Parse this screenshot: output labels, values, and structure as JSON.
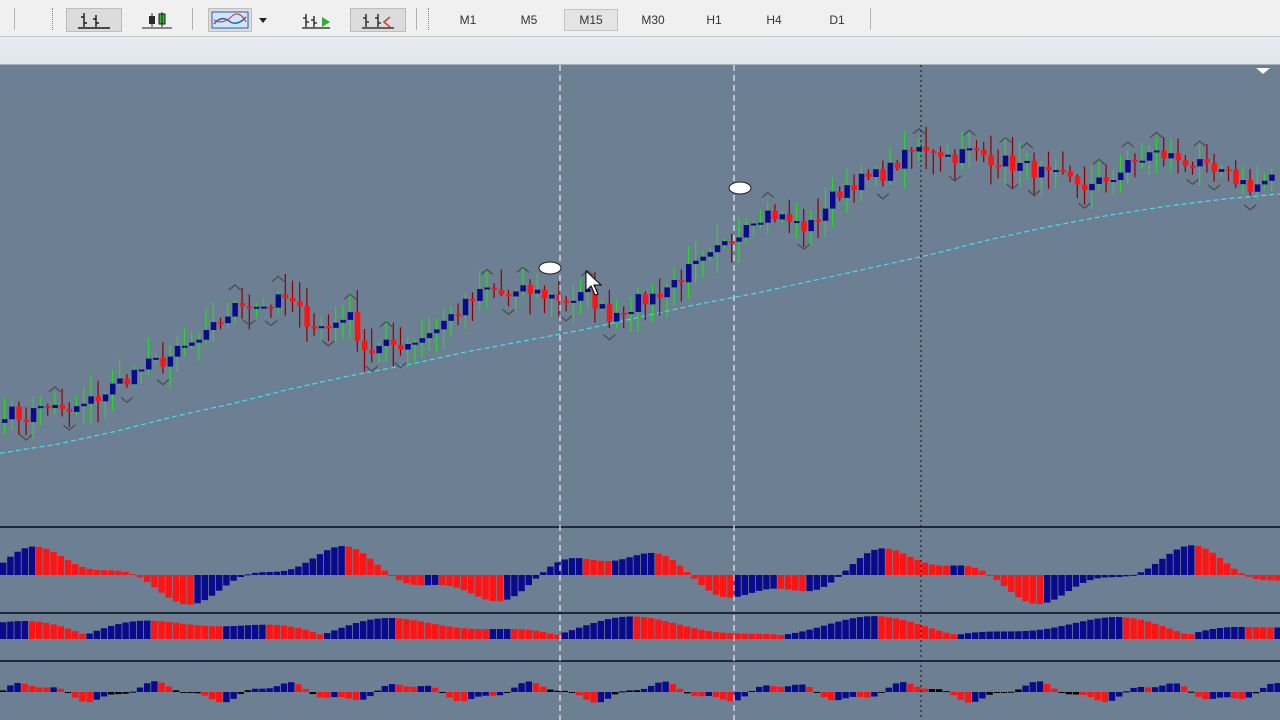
{
  "toolbar": {
    "timeframes": [
      "M1",
      "M5",
      "M15",
      "M30",
      "H1",
      "H4",
      "D1"
    ],
    "active_timeframe": "M15",
    "icons": [
      "bar-chart-icon",
      "candlestick-chart-icon",
      "line-chart-icon",
      "dropdown-arrow-icon",
      "zoom-in-icon",
      "zoom-out-icon"
    ]
  },
  "colors": {
    "background": "#6d7f92",
    "bull_candle": "#0a0a8c",
    "bear_candle": "#ff1414",
    "bull_wick": "#22dd22",
    "bear_wick": "#8b0000",
    "moving_average": "#40e0f0",
    "fractal": "#505050"
  },
  "chart_data": [
    {
      "type": "candlestick",
      "series": [
        {
          "name": "",
          "values": [
            6.2,
            5.8,
            6.6,
            6.0,
            6.5,
            7.2,
            8.0,
            8.6,
            9.0,
            9.6,
            10.2,
            11.4,
            12.2,
            11.9,
            12.3,
            11.2,
            10.6,
            11.6,
            9.4,
            9.7,
            9.9,
            10.4,
            11.2,
            12.0,
            12.8,
            12.4,
            12.7,
            12.5,
            12.2,
            12.5,
            11.4,
            11.9,
            12.3,
            13.0,
            13.8,
            14.4,
            15.4,
            16.7,
            17.0,
            16.5,
            16.1,
            17.6,
            18.6,
            18.8,
            19.3,
            20.2,
            20.6,
            20.0,
            20.3,
            20.0,
            19.6,
            19.4,
            18.9,
            18.7,
            18.3,
            18.9,
            19.6,
            20.2,
            20.0,
            19.7,
            19.1,
            18.9,
            18.4,
            18.8
          ]
        },
        {
          "name": "moving-average",
          "values": [
            3.9,
            4.4,
            5.1,
            5.9,
            6.6,
            7.4,
            8.1,
            8.7,
            9.4,
            10.0,
            10.6,
            11.3,
            12.0,
            12.6,
            13.3,
            14.0,
            14.7,
            15.5,
            16.2,
            16.8,
            17.3,
            17.7,
            18.0
          ]
        }
      ]
    },
    {
      "type": "bar",
      "series": [
        {
          "name": "",
          "values": []
        }
      ]
    },
    {
      "type": "bar",
      "series": [
        {
          "name": "",
          "values": []
        }
      ]
    },
    {
      "type": "bar",
      "series": [
        {
          "name": "",
          "values": []
        }
      ]
    }
  ]
}
